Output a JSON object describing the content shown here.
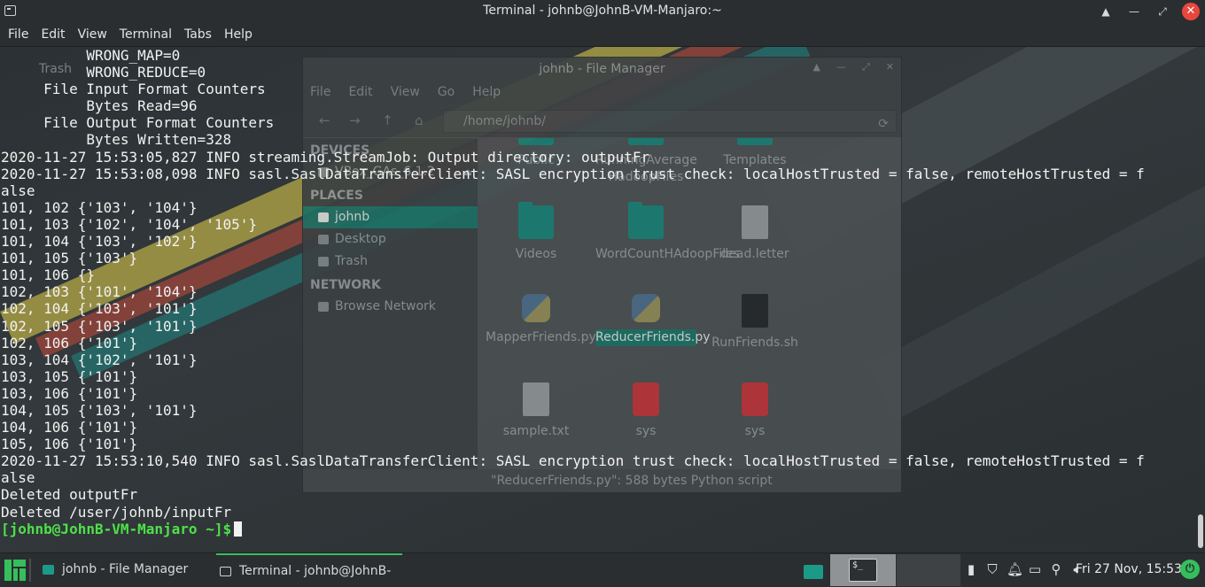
{
  "window": {
    "title": "Terminal - johnb@JohnB-VM-Manjaro:~",
    "controls": [
      "▲",
      "—",
      "⤢",
      "✕"
    ]
  },
  "menu": [
    "File",
    "Edit",
    "View",
    "Terminal",
    "Tabs",
    "Help"
  ],
  "terminal": {
    "lines": [
      "          WRONG_MAP=0",
      "          WRONG_REDUCE=0",
      "     File Input Format Counters",
      "          Bytes Read=96",
      "     File Output Format Counters",
      "          Bytes Written=328",
      "2020-11-27 15:53:05,827 INFO streaming.StreamJob: Output directory: outputFr",
      "2020-11-27 15:53:08,098 INFO sasl.SaslDataTransferClient: SASL encryption trust check: localHostTrusted = false, remoteHostTrusted = f",
      "alse",
      "101, 102 {'103', '104'}",
      "101, 103 {'102', '104', '105'}",
      "101, 104 {'103', '102'}",
      "101, 105 {'103'}",
      "101, 106 {}",
      "102, 103 {'101', '104'}",
      "102, 104 {'103', '101'}",
      "102, 105 {'103', '101'}",
      "102, 106 {'101'}",
      "103, 104 {'102', '101'}",
      "103, 105 {'101'}",
      "103, 106 {'101'}",
      "104, 105 {'103', '101'}",
      "104, 106 {'101'}",
      "105, 106 {'101'}",
      "2020-11-27 15:53:10,540 INFO sasl.SaslDataTransferClient: SASL encryption trust check: localHostTrusted = false, remoteHostTrusted = f",
      "alse",
      "Deleted outputFr",
      "Deleted /user/johnb/inputFr"
    ],
    "prompt": "[johnb@JohnB-VM-Manjaro ~]$"
  },
  "file_manager": {
    "title": "johnb - File Manager",
    "menu": [
      "File",
      "Edit",
      "View",
      "Go",
      "Help"
    ],
    "path": "/home/johnb/",
    "sidebar": {
      "devices_header": "DEVICES",
      "devices": [
        "VBox_GAs_6.1.2"
      ],
      "places_header": "PLACES",
      "places": [
        "johnb",
        "Desktop",
        "Trash"
      ],
      "network_header": "NETWORK",
      "network": [
        "Browse Network"
      ]
    },
    "files": [
      {
        "name": "Public",
        "icon": "folder-icon"
      },
      {
        "name": "RunningAverage HadoopFiles",
        "icon": "folder-icon"
      },
      {
        "name": "Templates",
        "icon": "folder-icon"
      },
      {
        "name": "Videos",
        "icon": "folder-icon"
      },
      {
        "name": "WordCountHAdoopFiles",
        "icon": "folder-icon"
      },
      {
        "name": "dead.letter",
        "icon": "text-file-icon"
      },
      {
        "name": "MapperFriends.py",
        "icon": "python-file-icon"
      },
      {
        "name": "ReducerFriends.py",
        "icon": "python-file-icon"
      },
      {
        "name": "RunFriends.sh",
        "icon": "script-file-icon"
      },
      {
        "name": "sample.txt",
        "icon": "text-file-icon"
      },
      {
        "name": "sys",
        "icon": "sys-icon"
      },
      {
        "name": "sys",
        "icon": "sys-icon"
      }
    ],
    "status": "\"ReducerFriends.py\": 588 bytes Python script"
  },
  "desktop": {
    "icons": [
      "Trash"
    ]
  },
  "taskbar": {
    "tasks": [
      "johnb - File Manager",
      "Terminal - johnb@JohnB-V..."
    ],
    "workspace_label": "$_",
    "clock": "Fri 27 Nov, 15:53"
  },
  "colors": {
    "prompt": "#4fe04a",
    "accent": "#35bf5c",
    "selection": "#1e6f64"
  }
}
